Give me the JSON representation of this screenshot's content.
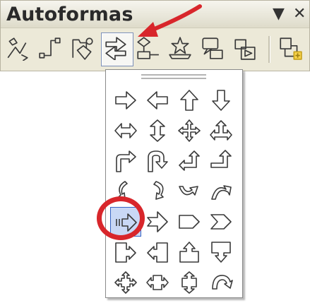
{
  "toolbar": {
    "title": "Autoformas",
    "menu_glyph": "▼",
    "close_glyph": "✕",
    "buttons": [
      {
        "icon": "basic-shapes-icon"
      },
      {
        "icon": "lines-connectors-icon"
      },
      {
        "icon": "flowchart-icon"
      },
      {
        "icon": "block-arrows-icon",
        "pressed": true
      },
      {
        "icon": "flowchart-shapes-icon"
      },
      {
        "icon": "stars-banners-icon"
      },
      {
        "icon": "callouts-icon"
      },
      {
        "icon": "action-buttons-icon"
      },
      {
        "icon": "more-autoshapes-icon"
      }
    ]
  },
  "dropdown": {
    "name": "block-arrows-palette",
    "shapes": [
      "right-arrow-icon",
      "left-arrow-icon",
      "up-arrow-icon",
      "down-arrow-icon",
      "left-right-arrow-icon",
      "up-down-arrow-icon",
      "quad-arrow-icon",
      "left-right-up-arrow-icon",
      "bent-arrow-icon",
      "u-turn-arrow-icon",
      "left-up-arrow-icon",
      "bent-up-arrow-icon",
      "curved-right-arrow-icon",
      "curved-left-arrow-icon",
      "curved-up-arrow-icon",
      "curved-down-arrow-icon",
      "striped-right-arrow-icon",
      "notched-right-arrow-icon",
      "pentagon-icon",
      "chevron-icon",
      "right-arrow-callout-icon",
      "left-arrow-callout-icon",
      "up-arrow-callout-icon",
      "down-arrow-callout-icon",
      "quad-arrow-callout-icon",
      "left-right-arrow-callout-icon",
      "up-down-arrow-callout-icon",
      "circular-arrow-icon"
    ],
    "selected_index": 16
  },
  "colors": {
    "annotation": "#d8262b",
    "toolbar_bg": "#ece9d8",
    "selection": "#c9d8f5",
    "selection_border": "#3663c4"
  }
}
